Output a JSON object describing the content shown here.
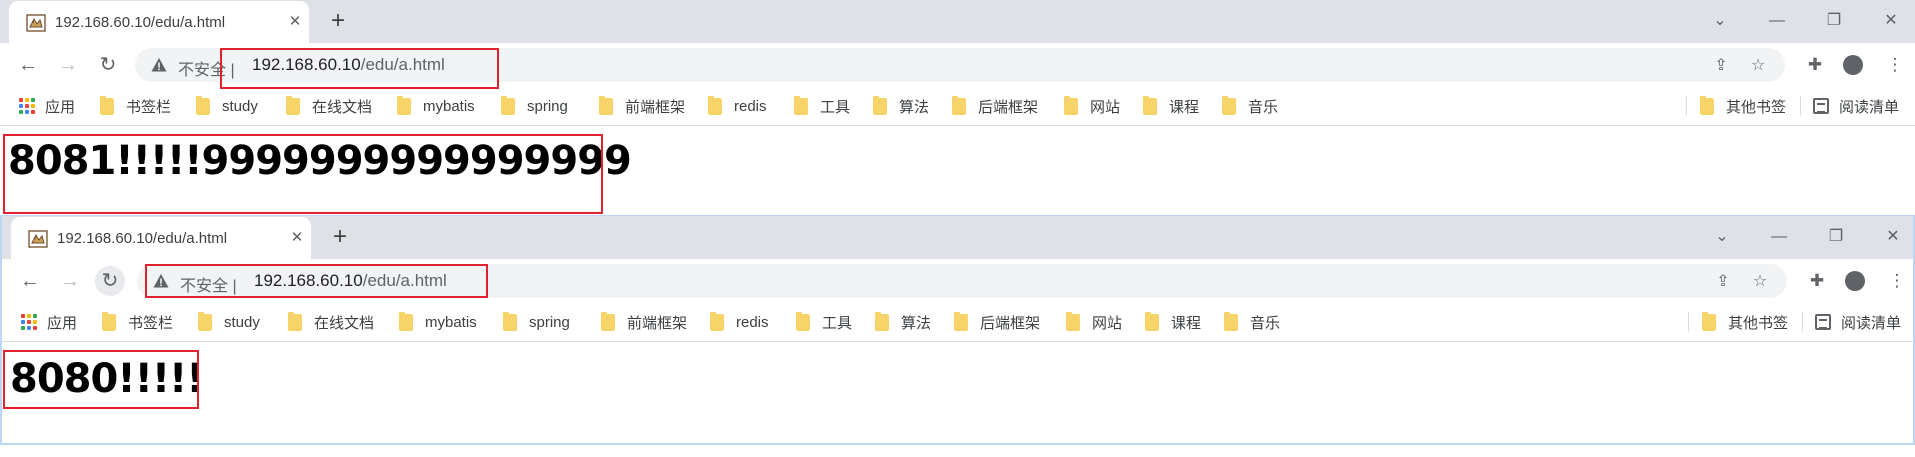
{
  "colors": {
    "accent_red": "#e0222e",
    "tab_bar": "#dee1e6",
    "folder": "#f7d46a",
    "omnibox": "#f1f3f4"
  },
  "windows": [
    {
      "tab": {
        "title": "192.168.60.10/edu/a.html",
        "favicon": "tomcat-icon"
      },
      "address": {
        "security_label": "不安全",
        "separator": "|",
        "host": "192.168.60.10",
        "path": "/edu/a.html"
      },
      "page": {
        "heading": "8081!!!!!9999999999999999"
      }
    },
    {
      "tab": {
        "title": "192.168.60.10/edu/a.html",
        "favicon": "tomcat-icon"
      },
      "address": {
        "security_label": "不安全",
        "separator": "|",
        "host": "192.168.60.10",
        "path": "/edu/a.html"
      },
      "page": {
        "heading": "8080!!!!!"
      }
    }
  ],
  "bookmarks": {
    "apps_label": "应用",
    "items": [
      "书签栏",
      "study",
      "在线文档",
      "mybatis",
      "spring",
      "前端框架",
      "redis",
      "工具",
      "算法",
      "后端框架",
      "网站",
      "课程",
      "音乐"
    ],
    "other_label": "其他书签",
    "reading_list_label": "阅读清单"
  },
  "icons": {
    "back": "back-arrow-icon",
    "forward": "forward-arrow-icon",
    "reload": "reload-icon",
    "share": "share-icon",
    "star": "bookmark-star-icon",
    "extensions": "puzzle-icon",
    "profile": "profile-icon",
    "menu": "kebab-menu-icon",
    "warning": "warning-triangle-icon"
  }
}
